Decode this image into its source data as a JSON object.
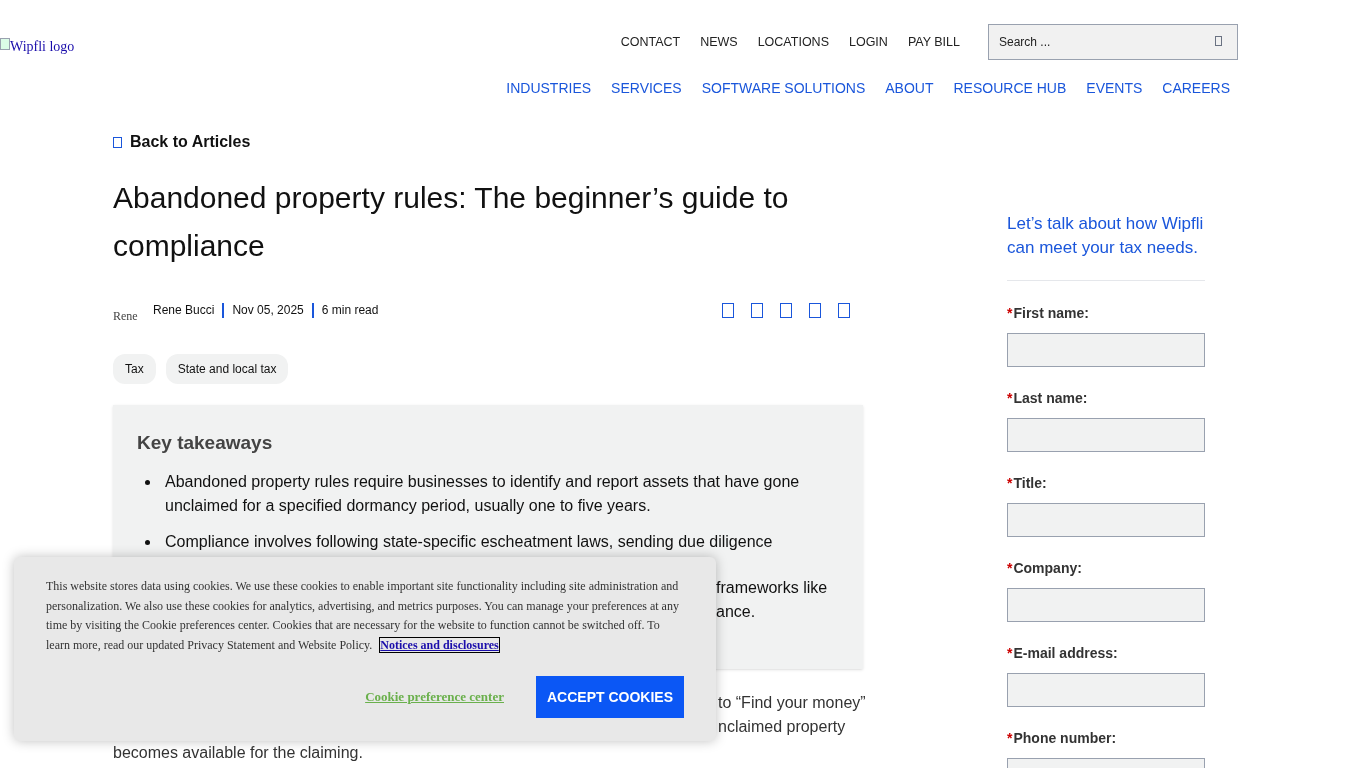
{
  "header": {
    "logo_alt": "Wipfli logo",
    "utility_nav": [
      "CONTACT",
      "NEWS",
      "LOCATIONS",
      "LOGIN",
      "PAY BILL"
    ],
    "search": {
      "placeholder": "Search ..."
    },
    "main_nav": [
      "INDUSTRIES",
      "SERVICES",
      "SOFTWARE SOLUTIONS",
      "ABOUT",
      "RESOURCE HUB",
      "EVENTS",
      "CAREERS"
    ]
  },
  "article": {
    "back_link": "Back to Articles",
    "title": "Abandoned property rules: The beginner’s guide to compliance",
    "author_avatar_alt": "Rene",
    "meta": [
      "Rene Bucci",
      "Nov 05, 2025",
      "6 min read"
    ],
    "tags": [
      "Tax",
      "State and local tax"
    ],
    "takeaways": {
      "heading": "Key takeaways",
      "items": [
        {
          "kind": "bullet",
          "text": "Abandoned property rules require businesses to identify and report assets that have gone unclaimed for a specified dormancy period, usually one to five years."
        },
        {
          "kind": "line",
          "text": "Compliance involves following state-specific escheatment laws, sending due diligence"
        },
        {
          "kind": "fragments",
          "fragments": [
            "frameworks like",
            "ance."
          ]
        }
      ]
    },
    "body_fragments": [
      {
        "kind": "right",
        "text": "to “Find your money”"
      },
      {
        "kind": "right",
        "text": "nclaimed property"
      },
      {
        "kind": "left",
        "text": "becomes available for the claiming."
      }
    ]
  },
  "sidebar": {
    "heading": "Let’s talk about how Wipfli can meet your tax needs.",
    "fields": [
      {
        "label": "First name:",
        "required_mark": "*"
      },
      {
        "label": "Last name:",
        "required_mark": "*"
      },
      {
        "label": "Title:",
        "required_mark": "*"
      },
      {
        "label": "Company:",
        "required_mark": "*"
      },
      {
        "label": "E-mail address:",
        "required_mark": "*"
      },
      {
        "label": "Phone number:",
        "required_mark": "*"
      }
    ]
  },
  "cookie_banner": {
    "text": "This website stores data using cookies. We use these cookies to enable important site functionality including site administration and personalization. We also use these cookies for analytics, advertising, and metrics purposes. You can manage your preferences at any time by visiting the Cookie preferences center. Cookies that are necessary for the website to function cannot be switched off. To learn more, read our updated Privacy Statement and Website Policy.",
    "link": "Notices and disclosures",
    "preference_link": "Cookie preference center",
    "accept_button": "ACCEPT COOKIES"
  }
}
